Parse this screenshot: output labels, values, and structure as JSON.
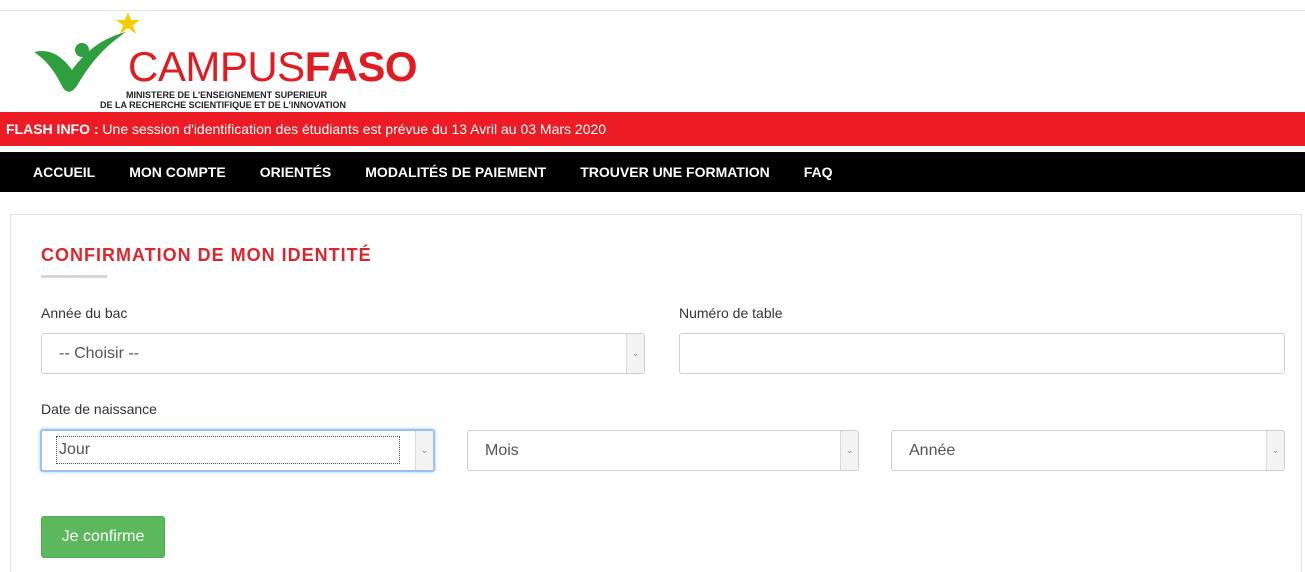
{
  "logo": {
    "word_part1": "CAMPUS",
    "word_part2": "FASO",
    "subtitle_line1": "MINISTERE DE L'ENSEIGNEMENT SUPERIEUR",
    "subtitle_line2": "DE LA RECHERCHE SCIENTIFIQUE ET DE L'INNOVATION"
  },
  "flash": {
    "label": "FLASH INFO :",
    "message": " Une session d'identification des étudiants est prévue du 13 Avril au 03 Mars 2020"
  },
  "nav": {
    "items": [
      "ACCUEIL",
      "MON COMPTE",
      "ORIENTÉS",
      "MODALITÉS DE PAIEMENT",
      "TROUVER UNE FORMATION",
      "FAQ"
    ]
  },
  "form": {
    "title": "CONFIRMATION DE MON IDENTITÉ",
    "bac_year": {
      "label": "Année du bac",
      "selected": "-- Choisir --"
    },
    "table_number": {
      "label": "Numéro de table",
      "value": ""
    },
    "birth_date": {
      "label": "Date de naissance",
      "day": "Jour",
      "month": "Mois",
      "year": "Année"
    },
    "submit_label": "Je confirme"
  },
  "colors": {
    "brand_red": "#ed1c24",
    "brand_green": "#2e9e3f",
    "star_yellow": "#f5d000",
    "button_green": "#5cb85c"
  }
}
